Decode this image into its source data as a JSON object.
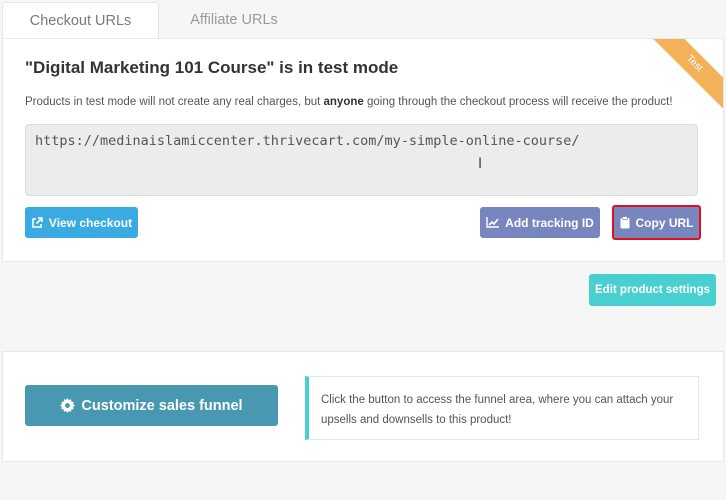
{
  "tabs": [
    {
      "label": "Checkout URLs",
      "active": true
    },
    {
      "label": "Affiliate URLs",
      "active": false
    }
  ],
  "card": {
    "title": "\"Digital Marketing 101 Course\" is in test mode",
    "desc_before": "Products in test mode will not create any real charges, but ",
    "desc_bold": "anyone",
    "desc_after": " going through the checkout process will receive the product!",
    "url": "https://medinaislamiccenter.thrivecart.com/my-simple-online-course/",
    "ribbon": "Test",
    "view_checkout_label": "View checkout",
    "add_tracking_label": "Add tracking ID",
    "copy_url_label": "Copy URL"
  },
  "edit_settings_label": "Edit product settings",
  "funnel": {
    "button_label": "Customize sales funnel",
    "info_line1": "Click the button to access the funnel area, where you can attach your",
    "info_line2": "upsells and downsells to this product!"
  },
  "icons": {
    "view": "external-link-icon",
    "tracking": "chart-line-icon",
    "copy": "clipboard-icon",
    "funnel": "gear-icon"
  },
  "colors": {
    "view_button": "#3aabe2",
    "secondary_button": "#7886c0",
    "highlight_border": "#e3101a",
    "edit_button": "#48cfd0",
    "funnel_button": "#4798b0",
    "ribbon": "#f2a948"
  }
}
